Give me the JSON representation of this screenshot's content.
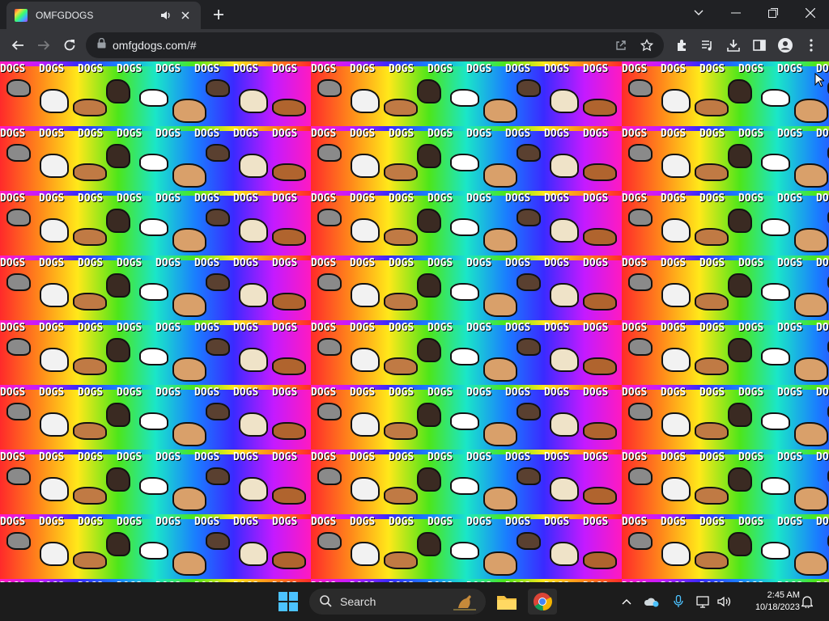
{
  "browser": {
    "tab_title": "OMFGDOGS",
    "url": "omfgdogs.com/#"
  },
  "page": {
    "tile_word": "DOGS",
    "rainbow": [
      "#ff2a2a",
      "#ff8a1a",
      "#ffe81a",
      "#4de61a",
      "#1ae6c8",
      "#1a7dff",
      "#3a2aff",
      "#c41aff",
      "#ff1ac0"
    ]
  },
  "taskbar": {
    "search_label": "Search",
    "time": "2:45 AM",
    "date": "10/18/2023"
  }
}
